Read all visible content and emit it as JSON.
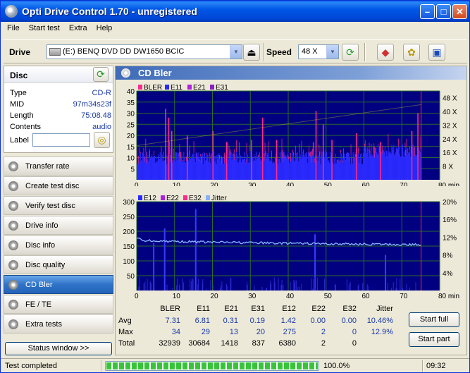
{
  "window": {
    "title": "Opti Drive Control 1.70 - unregistered"
  },
  "menu": [
    "File",
    "Start test",
    "Extra",
    "Help"
  ],
  "toolbar": {
    "drive_label": "Drive",
    "drive_value": "(E:)  BENQ DVD DD DW1650 BCIC",
    "speed_label": "Speed",
    "speed_value": "48 X"
  },
  "disc": {
    "header": "Disc",
    "rows": [
      {
        "k": "Type",
        "v": "CD-R"
      },
      {
        "k": "MID",
        "v": "97m34s23f"
      },
      {
        "k": "Length",
        "v": "75:08.48"
      },
      {
        "k": "Contents",
        "v": "audio"
      }
    ],
    "label_key": "Label"
  },
  "nav": [
    "Transfer rate",
    "Create test disc",
    "Verify test disc",
    "Drive info",
    "Disc info",
    "Disc quality",
    "CD Bler",
    "FE / TE",
    "Extra tests"
  ],
  "nav_active": 6,
  "status_window_label": "Status window >>",
  "panel_title": "CD Bler",
  "chart_data": [
    {
      "type": "bar",
      "legend": [
        "BLER",
        "E11",
        "E21",
        "E31"
      ],
      "legend_colors": [
        "#ff2a8a",
        "#2a2aff",
        "#b020e0",
        "#8a20c0"
      ],
      "x_ticks": [
        "0",
        "10",
        "20",
        "30",
        "40",
        "50",
        "60",
        "70",
        "80 min"
      ],
      "y_ticks_left": [
        "40",
        "35",
        "30",
        "25",
        "20",
        "15",
        "10",
        "5"
      ],
      "y_ticks_right": [
        "48 X",
        "40 X",
        "32 X",
        "24 X",
        "16 X",
        "8 X"
      ],
      "xlim": [
        0,
        80
      ],
      "ylim": [
        0,
        40
      ],
      "disc_end_min": 75.1,
      "base_level": 10,
      "peaks": [
        [
          7.5,
          32
        ],
        [
          8.3,
          28
        ],
        [
          9.1,
          22
        ],
        [
          13.2,
          20
        ],
        [
          20,
          22
        ],
        [
          23.6,
          17
        ],
        [
          30.2,
          18
        ],
        [
          33.1,
          28
        ],
        [
          36.8,
          18
        ],
        [
          47.2,
          31
        ],
        [
          49.1,
          25
        ],
        [
          51.4,
          18
        ],
        [
          57.9,
          21
        ],
        [
          64.2,
          17
        ],
        [
          72.5,
          22
        ],
        [
          74.1,
          30
        ]
      ]
    },
    {
      "type": "line",
      "legend": [
        "E12",
        "E22",
        "E32",
        "Jitter"
      ],
      "legend_colors": [
        "#2a2aff",
        "#b020e0",
        "#ff2a8a",
        "#8ab0ff"
      ],
      "x_ticks": [
        "0",
        "10",
        "20",
        "30",
        "40",
        "50",
        "60",
        "70",
        "80 min"
      ],
      "y_ticks_left": [
        "300",
        "250",
        "200",
        "150",
        "100",
        "50"
      ],
      "y_ticks_right": [
        "20%",
        "16%",
        "12%",
        "8%",
        "4%"
      ],
      "xlim": [
        0,
        80
      ],
      "ylim": [
        0,
        300
      ],
      "jitter_start_pct": 11.5,
      "jitter_end_pct": 10.3,
      "e12_spikes": [
        [
          4.3,
          160
        ],
        [
          15.4,
          275
        ],
        [
          7.2,
          210
        ],
        [
          46.9,
          190
        ],
        [
          65.5,
          120
        ]
      ]
    }
  ],
  "stats": {
    "columns": [
      "BLER",
      "E11",
      "E21",
      "E31",
      "E12",
      "E22",
      "E32",
      "Jitter"
    ],
    "rows": [
      {
        "label": "Avg",
        "values": [
          "7.31",
          "6.81",
          "0.31",
          "0.19",
          "1.42",
          "0.00",
          "0.00",
          "10.46%"
        ]
      },
      {
        "label": "Max",
        "values": [
          "34",
          "29",
          "13",
          "20",
          "275",
          "2",
          "0",
          "12.9%"
        ]
      },
      {
        "label": "Total",
        "values": [
          "32939",
          "30684",
          "1418",
          "837",
          "6380",
          "2",
          "0",
          ""
        ]
      }
    ]
  },
  "buttons": {
    "start_full": "Start full",
    "start_part": "Start part"
  },
  "status": {
    "text": "Test completed",
    "progress_pct": 100,
    "progress_label": "100.0%",
    "time": "09:32"
  },
  "colors": {
    "accent": "#2f73c8",
    "chart_bg": "#000080",
    "grid": "#2a6a2a"
  }
}
